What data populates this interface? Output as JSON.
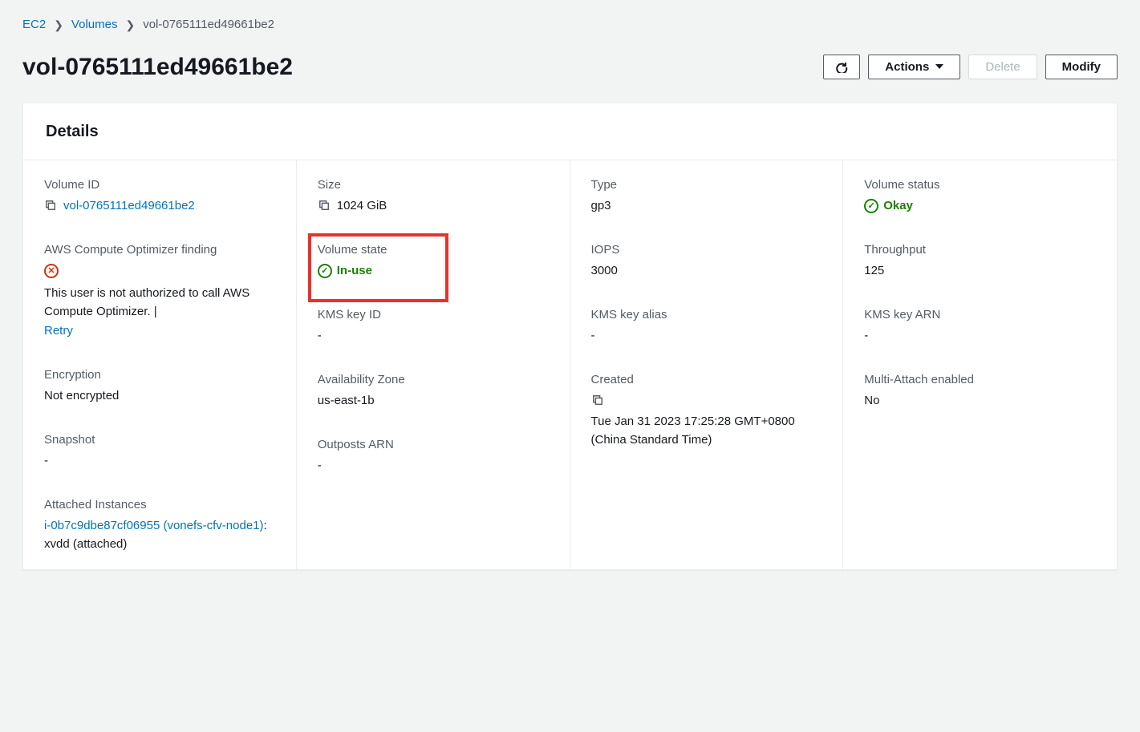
{
  "breadcrumb": {
    "root": "EC2",
    "volumes": "Volumes",
    "current": "vol-0765111ed49661be2"
  },
  "header": {
    "title": "vol-0765111ed49661be2",
    "actions_label": "Actions",
    "delete_label": "Delete",
    "modify_label": "Modify"
  },
  "panel": {
    "title": "Details"
  },
  "col1": {
    "volume_id": {
      "label": "Volume ID",
      "value": "vol-0765111ed49661be2"
    },
    "optimizer": {
      "label": "AWS Compute Optimizer finding",
      "error_text": "This user is not authorized to call AWS Compute Optimizer. |",
      "retry": "Retry"
    },
    "encryption": {
      "label": "Encryption",
      "value": "Not encrypted"
    },
    "snapshot": {
      "label": "Snapshot",
      "value": "-"
    },
    "attached": {
      "label": "Attached Instances",
      "link": "i-0b7c9dbe87cf06955 (vonefs-cfv-node1)",
      "suffix": ": xvdd (attached)"
    }
  },
  "col2": {
    "size": {
      "label": "Size",
      "value": "1024 GiB"
    },
    "state": {
      "label": "Volume state",
      "value": "In-use"
    },
    "kms_id": {
      "label": "KMS key ID",
      "value": "-"
    },
    "az": {
      "label": "Availability Zone",
      "value": "us-east-1b"
    },
    "outposts": {
      "label": "Outposts ARN",
      "value": "-"
    }
  },
  "col3": {
    "type": {
      "label": "Type",
      "value": "gp3"
    },
    "iops": {
      "label": "IOPS",
      "value": "3000"
    },
    "kms_alias": {
      "label": "KMS key alias",
      "value": "-"
    },
    "created": {
      "label": "Created",
      "value": "Tue Jan 31 2023 17:25:28 GMT+0800 (China Standard Time)"
    }
  },
  "col4": {
    "status": {
      "label": "Volume status",
      "value": "Okay"
    },
    "throughput": {
      "label": "Throughput",
      "value": "125"
    },
    "kms_arn": {
      "label": "KMS key ARN",
      "value": "-"
    },
    "multi": {
      "label": "Multi-Attach enabled",
      "value": "No"
    }
  }
}
